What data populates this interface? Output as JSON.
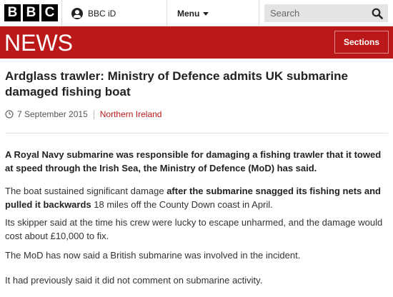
{
  "header": {
    "logo_letters": [
      "B",
      "B",
      "C"
    ],
    "bbcid_label": "BBC iD",
    "menu_label": "Menu",
    "search_placeholder": "Search"
  },
  "banner": {
    "title": "NEWS",
    "sections_label": "Sections"
  },
  "article": {
    "headline": "Ardglass trawler: Ministry of Defence admits UK submarine damaged fishing boat",
    "date": "7 September 2015",
    "category": "Northern Ireland",
    "intro": "A Royal Navy submarine was responsible for damaging a fishing trawler that it towed at speed through the Irish Sea, the Ministry of Defence (MoD) has said.",
    "p2_before": "The boat sustained significant damage ",
    "p2_bold": "after the submarine snagged its fishing nets and pulled it backwards",
    "p2_after": " 18 miles off the County Down coast in April.",
    "p3": "Its skipper said at the time his crew were lucky to escape unharmed, and the damage would cost about £10,000 to fix.",
    "p4": "The MoD has now said a British submarine was involved in the incident.",
    "p5": "It had previously said it did not comment on submarine activity."
  },
  "colors": {
    "brand_red": "#bb1919",
    "topbar_bg": "#ffffff",
    "search_bg": "#e4e4e4"
  },
  "icons": {
    "account": "person-icon",
    "menu": "chevron-down-icon",
    "search": "search-icon",
    "date": "clock-icon"
  }
}
